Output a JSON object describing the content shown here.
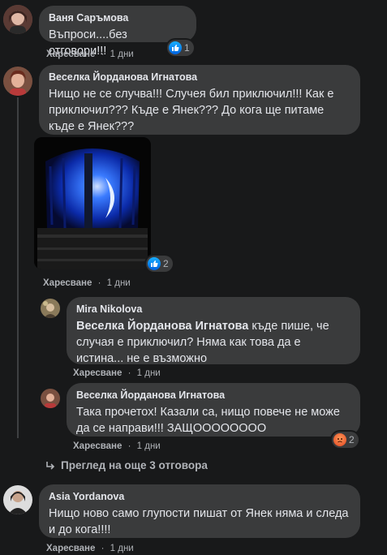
{
  "comments": [
    {
      "author": "Ваня Саръмова",
      "text": "Въпроси....без отговори!!!",
      "like_label": "Харесване",
      "time": "1 дни",
      "reactions": "1"
    },
    {
      "author": "Веселка Йорданова Игнатова",
      "text": "Нищо не се случва!!! Случея бил приключил!!! Как е приключил??? Къде е Янек??? До кога ще питаме къде е Янек???",
      "like_label": "Харесване",
      "time": "1 дни",
      "reactions": "2"
    },
    {
      "author": "Mira Nikolova",
      "mention": "Веселка Йорданова Игнатова",
      "text": " къде пише, че случая е приключил? Няма как това да е истина... не е възможно",
      "like_label": "Харесване",
      "time": "1 дни"
    },
    {
      "author": "Веселка Йорданова Игнатова",
      "text": "Така прочетох! Казали са, нищо повече не може да се направи!!! ЗАЩОООООООО",
      "like_label": "Харесване",
      "time": "1 дни",
      "reactions": "2"
    },
    {
      "author": "Asia Yordanova",
      "text": "Нищо ново само глупости пишат от Янек няма и следа и до кога!!!!",
      "like_label": "Харесване",
      "time": "1 дни"
    }
  ],
  "view_more_replies": "Преглед на още 3 отговора",
  "separator": "·",
  "colors": {
    "background": "#18191a",
    "bubble": "#3a3b3c",
    "like_blue": "#1877f2",
    "siren_blue": "#2a4fff"
  },
  "icons": [
    "like-icon",
    "sad-icon",
    "reply-arrow-icon",
    "siren-gif"
  ]
}
